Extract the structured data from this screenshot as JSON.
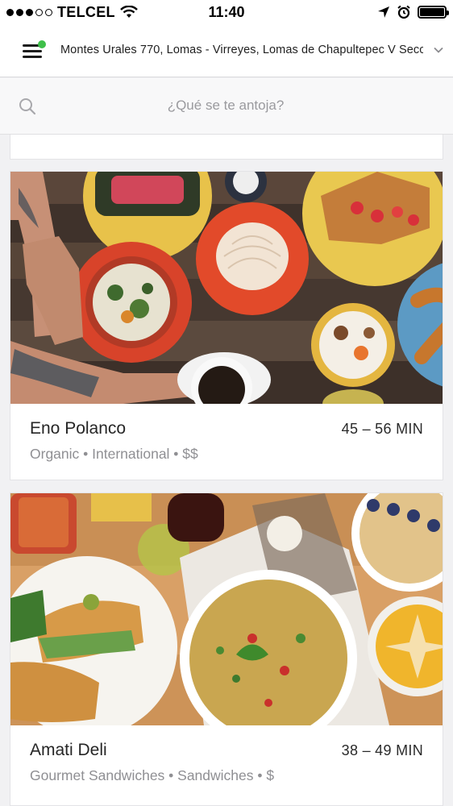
{
  "status_bar": {
    "carrier": "TELCEL",
    "time": "11:40"
  },
  "header": {
    "address": "Montes Urales 770, Lomas - Virreyes, Lomas de Chapultepec V Secc"
  },
  "search": {
    "placeholder": "¿Qué se te antoja?"
  },
  "restaurants": [
    {
      "name": "Eno Polanco",
      "eta": "45 – 56 MIN",
      "meta": "Organic • International • $$"
    },
    {
      "name": "Amati Deli",
      "eta": "38 – 49 MIN",
      "meta": "Gourmet Sandwiches • Sandwiches • $"
    }
  ],
  "colors": {
    "notification": "#3fbf4a",
    "background": "#f1f1f3"
  }
}
